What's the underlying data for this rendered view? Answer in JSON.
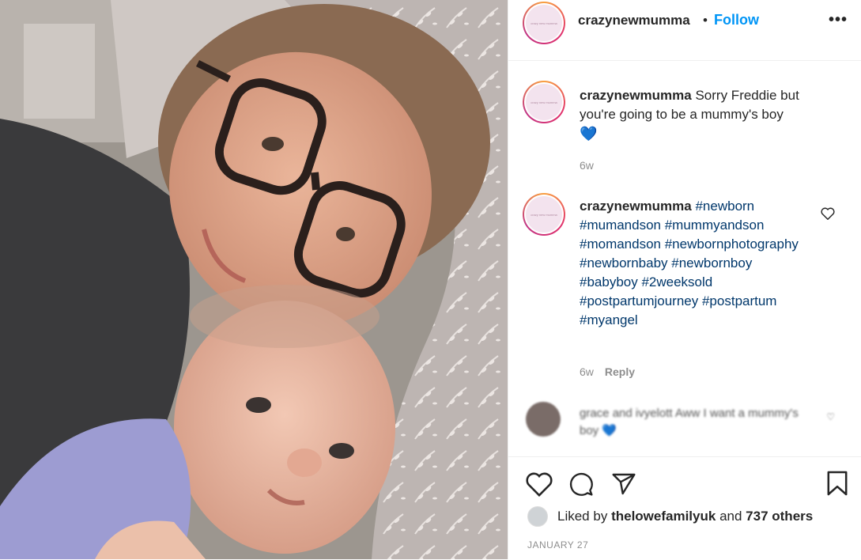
{
  "post": {
    "username": "crazynewmumma",
    "dot": "•",
    "follow_label": "Follow",
    "more_label": "•••",
    "avatar_text": "crazy new mumma"
  },
  "comments": [
    {
      "username": "crazynewmumma",
      "text": "Sorry Freddie but you're going to be a mummy's boy",
      "emoji": "💙",
      "age": "6w"
    },
    {
      "username": "crazynewmumma",
      "hashtags": "#newborn #mumandson #mummyandson #momandson #newbornphotography #newbornbaby #newbornboy #babyboy #2weeksold #postpartumjourney #postpartum #myangel",
      "age": "6w",
      "reply_label": "Reply"
    },
    {
      "username": "grace and ivyelott",
      "text": "Aww I want a mummy's boy",
      "emoji": "💙"
    }
  ],
  "likes": {
    "prefix": "Liked by",
    "user": "thelowefamilyuk",
    "mid": "and",
    "count": "737 others"
  },
  "date": "JANUARY 27",
  "colors": {
    "accent": "#0095f6",
    "hashtag": "#00376b",
    "muted": "#8e8e8e"
  },
  "icons": [
    "more-icon",
    "heart-icon",
    "comment-icon",
    "share-icon",
    "bookmark-icon"
  ]
}
